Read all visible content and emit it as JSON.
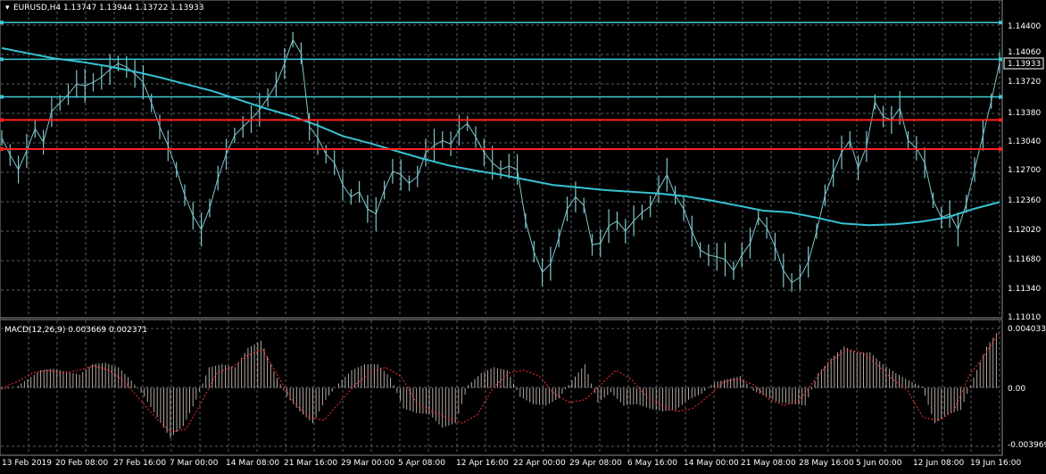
{
  "header": {
    "symbol_text": "EURUSD,H4  1.13747 1.13944 1.13722 1.13933"
  },
  "macd_header": {
    "text": "MACD(12,26,9) 0.003669 0.002371"
  },
  "price_axis": {
    "labels": [
      "1.14400",
      "1.14060",
      "1.13720",
      "1.13380",
      "1.13040",
      "1.12700",
      "1.12360",
      "1.12020",
      "1.11680",
      "1.11340",
      "1.11010"
    ],
    "current_price": "1.13933"
  },
  "macd_axis": {
    "labels": [
      "0.004033",
      "0.00",
      "-0.003969"
    ]
  },
  "time_axis": {
    "labels": [
      "13 Feb 2019",
      "20 Feb 08:00",
      "27 Feb 16:00",
      "7 Mar 00:00",
      "14 Mar 08:00",
      "21 Mar 16:00",
      "29 Mar 00:00",
      "5 Apr 08:00",
      "12 Apr 16:00",
      "22 Apr 00:00",
      "29 Apr 08:00",
      "6 May 16:00",
      "14 May 00:00",
      "21 May 08:00",
      "28 May 16:00",
      "5 Jun 00:00",
      "12 Jun 08:00",
      "19 Jun 16:00"
    ]
  },
  "chart_data": [
    {
      "type": "line",
      "title": "EURUSD,H4",
      "series": [
        {
          "name": "EURUSD",
          "values": [
            1.1305,
            1.1285,
            1.1268,
            1.129,
            1.1316,
            1.13,
            1.1336,
            1.1346,
            1.1356,
            1.1368,
            1.1366,
            1.137,
            1.1376,
            1.1385,
            1.1392,
            1.1388,
            1.138,
            1.137,
            1.1346,
            1.1318,
            1.1296,
            1.1268,
            1.1238,
            1.1214,
            1.1198,
            1.1223,
            1.1258,
            1.1286,
            1.1308,
            1.1318,
            1.1327,
            1.1338,
            1.1352,
            1.1368,
            1.1392,
            1.142,
            1.1404,
            1.1318,
            1.1305,
            1.1286,
            1.1276,
            1.125,
            1.1236,
            1.1242,
            1.1222,
            1.1216,
            1.1244,
            1.1266,
            1.1262,
            1.1252,
            1.126,
            1.1288,
            1.1296,
            1.1302,
            1.1298,
            1.1314,
            1.1322,
            1.1306,
            1.1288,
            1.1276,
            1.1268,
            1.1272,
            1.1268,
            1.1208,
            1.1172,
            1.1148,
            1.1158,
            1.1188,
            1.1222,
            1.1236,
            1.1226,
            1.118,
            1.1182,
            1.1202,
            1.1208,
            1.1196,
            1.1208,
            1.1218,
            1.1225,
            1.1245,
            1.1262,
            1.1238,
            1.1222,
            1.1196,
            1.1174,
            1.1168,
            1.1166,
            1.1163,
            1.115,
            1.1168,
            1.1182,
            1.1212,
            1.12,
            1.1178,
            1.115,
            1.1136,
            1.1142,
            1.116,
            1.1196,
            1.1238,
            1.1264,
            1.1288,
            1.1302,
            1.127,
            1.1295,
            1.1347,
            1.133,
            1.1326,
            1.134,
            1.1302,
            1.1293,
            1.1276,
            1.1232,
            1.1212,
            1.1216,
            1.1198,
            1.1228,
            1.1268,
            1.1308,
            1.1348,
            1.1393
          ]
        },
        {
          "name": "MA",
          "values": [
            1.141,
            1.1404,
            1.1398,
            1.1394,
            1.1389,
            1.1383,
            1.1376,
            1.1368,
            1.136,
            1.135,
            1.134,
            1.1331,
            1.132,
            1.1307,
            1.1299,
            1.129,
            1.1281,
            1.1273,
            1.1267,
            1.1262,
            1.1256,
            1.125,
            1.1247,
            1.1244,
            1.1242,
            1.124,
            1.1237,
            1.1232,
            1.1226,
            1.122,
            1.1218,
            1.1212,
            1.1205,
            1.1203,
            1.1204,
            1.1207,
            1.1212,
            1.1222,
            1.123
          ]
        }
      ],
      "horizontal_lines": [
        {
          "price": 1.144,
          "color": "#3fc9d8"
        },
        {
          "price": 1.1397,
          "color": "#3fc9d8"
        },
        {
          "price": 1.1353,
          "color": "#3fc9d8"
        },
        {
          "price": 1.1326,
          "color": "#ff2020"
        },
        {
          "price": 1.1292,
          "color": "#ff2020"
        }
      ],
      "ylim": [
        1.1101,
        1.146
      ],
      "grid": true
    },
    {
      "type": "bar",
      "title": "MACD(12,26,9)",
      "series": [
        {
          "name": "MACD",
          "values": [
            -0.0001,
            0.0,
            0.0006,
            0.0012,
            0.0013,
            0.0011,
            0.0009,
            0.0016,
            0.0017,
            0.0014,
            0.0005,
            -0.0006,
            -0.002,
            -0.0034,
            -0.0026,
            -0.0008,
            0.0014,
            0.0016,
            0.0014,
            0.0027,
            0.0032,
            0.0011,
            -0.0006,
            -0.0016,
            -0.0024,
            -0.0008,
            0.0003,
            0.0012,
            0.0016,
            0.0016,
            0.0007,
            -0.0014,
            -0.0017,
            -0.0018,
            -0.0027,
            -0.0024,
            0.0002,
            0.001,
            0.0014,
            0.0012,
            -0.0006,
            -0.0011,
            -0.0012,
            -0.0007,
            0.0005,
            0.0016,
            -0.001,
            -0.0003,
            -0.0012,
            -0.0011,
            -0.0014,
            -0.0016,
            -0.0015,
            -0.0008,
            -0.0004,
            0.0004,
            0.0006,
            0.0008,
            -0.0002,
            -0.0006,
            -0.001,
            -0.0011,
            -0.0012,
            0.001,
            0.002,
            0.0028,
            0.0024,
            0.0024,
            0.0016,
            0.001,
            0.0005,
            0.0001,
            -0.0024,
            -0.0018,
            -0.0015,
            0.0007,
            0.0028,
            0.004
          ]
        },
        {
          "name": "Signal",
          "values": [
            0.0,
            0.0004,
            0.001,
            0.0012,
            0.001,
            0.0012,
            0.0015,
            0.0012,
            0.0004,
            -0.0008,
            -0.002,
            -0.003,
            -0.0028,
            -0.001,
            0.001,
            0.0014,
            0.0022,
            0.0026,
            0.0008,
            -0.001,
            -0.002,
            -0.0022,
            -0.001,
            0.0002,
            0.001,
            0.0014,
            0.0008,
            -0.001,
            -0.0016,
            -0.002,
            -0.0024,
            -0.0018,
            0.0,
            0.001,
            0.0012,
            0.0008,
            -0.0004,
            -0.001,
            -0.0008,
            0.0002,
            0.0012,
            0.0006,
            -0.0006,
            -0.0012,
            -0.0016,
            -0.0014,
            -0.0006,
            0.0004,
            0.0006,
            0.0002,
            -0.0008,
            -0.0012,
            -0.0008,
            0.0006,
            0.0018,
            0.0026,
            0.0024,
            0.0016,
            0.0006,
            -0.0002,
            -0.002,
            -0.0022,
            -0.0016,
            0.0008,
            0.0022,
            0.0038
          ]
        }
      ],
      "ylim": [
        -0.003969,
        0.004033
      ],
      "grid": true
    }
  ],
  "colors": {
    "background": "#000000",
    "grid": "#5a5f66",
    "price_line": "#7fc6cd",
    "ma": "#35c3d3",
    "support": "#ff2020",
    "resistance": "#3fc9d8",
    "macd_bar": "#b5a9a3",
    "macd_signal": "#ff3030",
    "text": "#ffffff"
  }
}
